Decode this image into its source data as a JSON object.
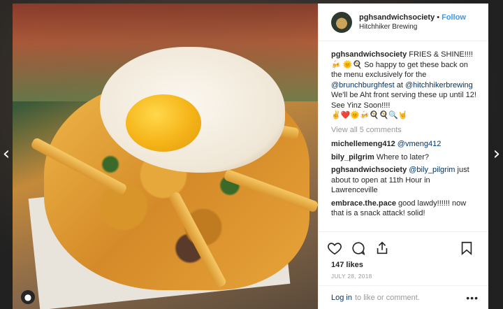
{
  "post": {
    "username": "pghsandwichsociety",
    "separator": "•",
    "follow_label": "Follow",
    "location": "Hitchhiker Brewing",
    "caption": {
      "username": "pghsandwichsociety",
      "text_1": "FRIES & SHINE!!!! 🍻",
      "text_2": "🌞🍳 So happy to get these back on the menu exclusively for the",
      "mention_1": "@brunchburghfest",
      "text_3": "at",
      "mention_2": "@hitchhikerbrewing",
      "text_4": "We'll be Aht front serving these up until 12! See Yinz Soon!!!!",
      "emojis": "✌️❤️🌞🍻🍳🍳🔍🤘"
    },
    "view_all": "View all 5 comments",
    "comments": [
      {
        "user": "michellemeng412",
        "mention": "@vmeng412",
        "text": ""
      },
      {
        "user": "bily_pilgrim",
        "mention": "",
        "text": "Where to later?"
      },
      {
        "user": "pghsandwichsociety",
        "mention": "@bily_pilgrim",
        "text": "just about to open at 11th Hour in Lawrenceville"
      },
      {
        "user": "embrace.the.pace",
        "mention": "",
        "text": "good lawdy!!!!!! now that is a snack attack! solid!"
      }
    ],
    "likes": "147 likes",
    "date": "JULY 28, 2018",
    "login_label": "Log in",
    "footer_text": "to like or comment.",
    "more_label": "•••",
    "nav_left": "‹",
    "nav_right": "›",
    "icons": {
      "heart": "heart-icon",
      "comment": "comment-icon",
      "share": "share-icon",
      "bookmark": "bookmark-icon",
      "user": "user-icon"
    },
    "colors": {
      "follow": "#3897f0",
      "mention": "#003569",
      "muted": "#999999"
    }
  }
}
